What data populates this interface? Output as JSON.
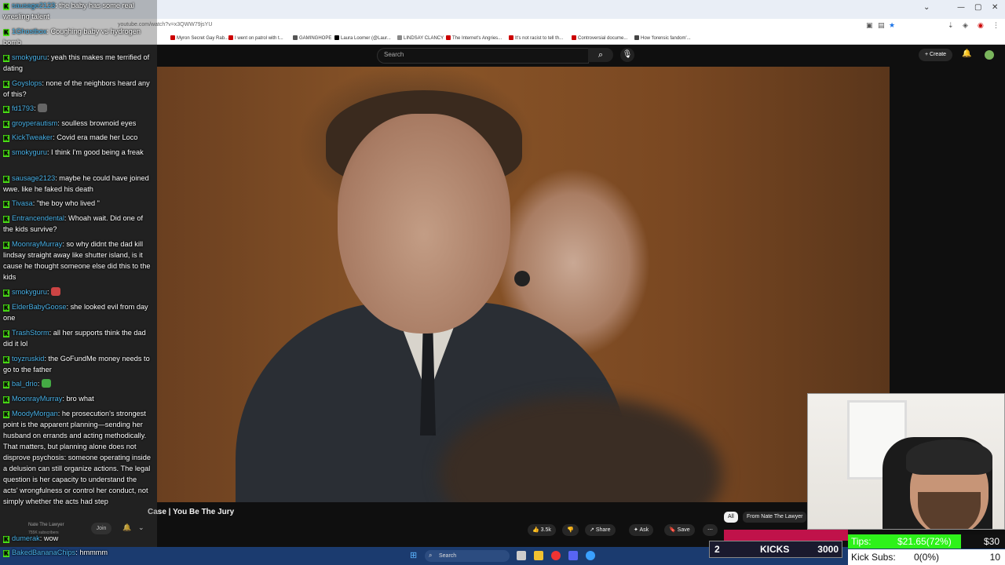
{
  "browser": {
    "url": "youtube.com/watch?v=x3QWW79jsYU",
    "bookmarks": [
      "Myron Secret Gay Rab...",
      "I went on patrol with t...",
      "GAMINGHOPE",
      "Laura Loomer (@Laur...",
      "LINDSAY CLANCY",
      "The Internet's Angries...",
      "It's not racist to tell th...",
      "Controversial docume...",
      "How 'forensic fandom'..."
    ],
    "window_controls": [
      "—",
      "▢",
      "✕"
    ]
  },
  "youtube": {
    "search_placeholder": "Search",
    "create_label": "Create",
    "video_title": "Case | You Be The Jury",
    "channel_name": "Nate The Lawyer",
    "subscribers": "755K subscribers",
    "join_label": "Join",
    "likes": "3.5k",
    "share_label": "Share",
    "ask_label": "Ask",
    "save_label": "Save",
    "chip_all": "All",
    "chip_channel": "From Nate The Lawyer"
  },
  "taskbar": {
    "search_label": "Search"
  },
  "chat": {
    "messages": [
      {
        "user": "sausage2123",
        "text": "the baby has some real wresling talent"
      },
      {
        "user": "1Ghostbox",
        "text": "Coughing baby vs hydrogen bomb"
      },
      {
        "user": "smokyguru",
        "text": "yeah this makes me terrified of dating"
      },
      {
        "user": "Goyslops",
        "text": "none of the neighbors heard any of this?"
      },
      {
        "user": "fd1793",
        "text": ""
      },
      {
        "user": "groyperautism",
        "text": "soulless brownoid eyes"
      },
      {
        "user": "KickTweaker",
        "text": "Covid era made her Loco"
      },
      {
        "user": "smokyguru",
        "text": "I think I'm good being a freak"
      },
      {
        "user": "sausage2123",
        "text": "maybe he could have joined wwe. like he faked his death"
      },
      {
        "user": "Tivasa",
        "text": "\"the boy who lived \""
      },
      {
        "user": "Entrancendental",
        "text": "Whoah wait. Did one of the kids survive?"
      },
      {
        "user": "MoonrayMurray",
        "text": "so why didnt the dad kill lindsay straight away like shutter island, is it cause he thought someone else did this to the kids"
      },
      {
        "user": "smokyguru",
        "text": ""
      },
      {
        "user": "ElderBabyGoose",
        "text": "she looked evil from day one"
      },
      {
        "user": "TrashStorm",
        "text": "all her supports think the dad did it lol"
      },
      {
        "user": "toyzruskid",
        "text": "the GoFundMe money needs to go to the father"
      },
      {
        "user": "bal_drio",
        "text": ""
      },
      {
        "user": "MoonrayMurray",
        "text": "bro what"
      },
      {
        "user": "MoodyMorgan",
        "text": "he prosecution's strongest point is the apparent planning—sending her husband on errands and acting methodically. That matters, but planning alone does not disprove psychosis: someone operating inside a delusion can still organize actions. The legal question is her capacity to understand the acts' wrongfulness or control her conduct, not simply whether the acts had step"
      },
      {
        "user": "dumerak",
        "text": "wow"
      },
      {
        "user": "BakedBananaChips",
        "text": "hmmmm"
      }
    ]
  },
  "overlay": {
    "kicks_count": "2",
    "kicks_label": "KICKS",
    "kicks_goal": "3000",
    "tips_label": "Tips:",
    "tips_value": "$21.65(72%)",
    "tips_goal": "$30",
    "subs_label": "Kick Subs:",
    "subs_value": "0(0%)",
    "subs_goal": "10"
  },
  "colors": {
    "kick_green": "#53fc18",
    "username_blue": "#4ab2e8",
    "taskbar": "#1b3b6f"
  }
}
